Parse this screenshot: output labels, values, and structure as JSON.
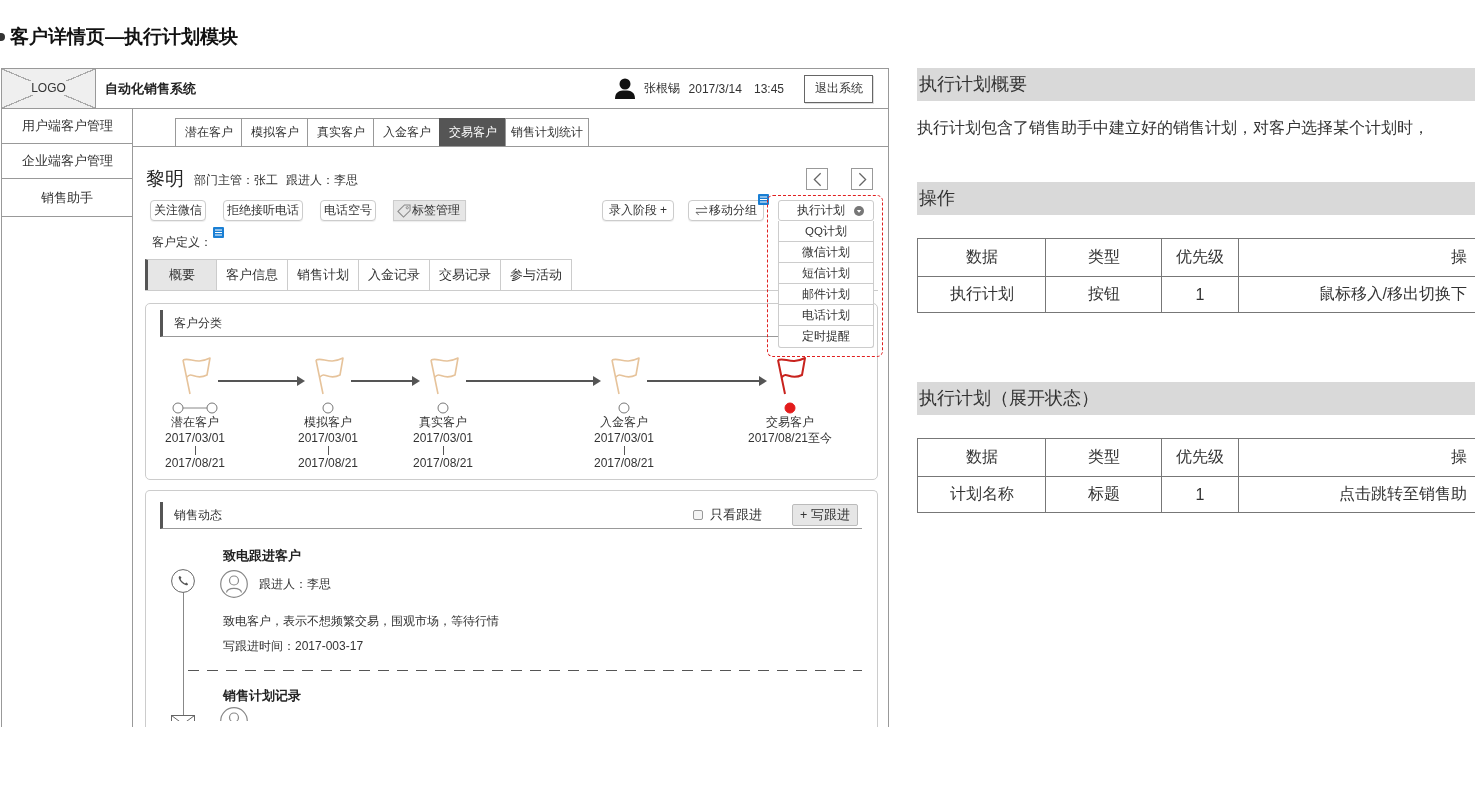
{
  "page": {
    "title": "客户详情页—执行计划模块"
  },
  "wireframe": {
    "header": {
      "logo": "LOGO",
      "system_name": "自动化销售系统",
      "user": "张根锡",
      "date": "2017/3/14",
      "time": "13:45",
      "logout": "退出系统"
    },
    "sidebar": [
      "用户端客户管理",
      "企业端客户管理",
      "销售助手"
    ],
    "top_tabs": [
      {
        "label": "潜在客户",
        "selected": false
      },
      {
        "label": "模拟客户",
        "selected": false
      },
      {
        "label": "真实客户",
        "selected": false
      },
      {
        "label": "入金客户",
        "selected": false
      },
      {
        "label": "交易客户",
        "selected": true
      },
      {
        "label": "销售计划统计",
        "selected": false
      }
    ],
    "customer": {
      "name": "黎明",
      "manager": "部门主管：张工",
      "follower": "跟进人：李思"
    },
    "actions_left": [
      {
        "kind": "plain",
        "label": "关注微信",
        "note_marker": false
      },
      {
        "kind": "plain",
        "label": "拒绝接听电话",
        "note_marker": false
      },
      {
        "kind": "plain",
        "label": "电话空号",
        "note_marker": false
      },
      {
        "kind": "tag",
        "label": "标签管理",
        "note_marker": false
      }
    ],
    "actions_right": [
      {
        "kind": "plain",
        "label": "录入阶段 +",
        "note_marker": false
      },
      {
        "kind": "move",
        "label": "移动分组",
        "note_marker": true
      }
    ],
    "execute_plan": {
      "label": "执行计划",
      "expanded": true,
      "highlighted": true,
      "items": [
        "QQ计划",
        "微信计划",
        "短信计划",
        "邮件计划",
        "电话计划",
        "定时提醒"
      ]
    },
    "customer_definition": {
      "label": "客户定义：",
      "note_marker": true
    },
    "detail_tabs": [
      {
        "label": "概要",
        "selected": true
      },
      {
        "label": "客户信息",
        "selected": false
      },
      {
        "label": "销售计划",
        "selected": false
      },
      {
        "label": "入金记录",
        "selected": false
      },
      {
        "label": "交易记录",
        "selected": false
      },
      {
        "label": "参与活动",
        "selected": false
      }
    ],
    "classification": {
      "title": "客户分类",
      "stages": [
        {
          "kind": "range",
          "name": "潜在客户",
          "start": "2017/03/01",
          "end": "2017/08/21",
          "current": false
        },
        {
          "kind": "point",
          "name": "模拟客户",
          "start": "2017/03/01",
          "end": "2017/08/21",
          "current": false
        },
        {
          "kind": "point",
          "name": "真实客户",
          "start": "2017/03/01",
          "end": "2017/08/21",
          "current": false
        },
        {
          "kind": "point",
          "name": "入金客户",
          "start": "2017/03/01",
          "end": "2017/08/21",
          "current": false
        },
        {
          "kind": "point",
          "name": "交易客户",
          "start": "2017/08/21至今",
          "current": true
        }
      ]
    },
    "sales_activity": {
      "title": "销售动态",
      "filter": {
        "label": "只看跟进",
        "checked": false
      },
      "write_button": "+ 写跟进",
      "entries": [
        {
          "kind": "call",
          "title": "致电跟进客户",
          "follower": "跟进人：李思",
          "note": "致电客户，表示不想频繁交易，围观市场，等待行情",
          "time": "写跟进时间：2017-003-17"
        },
        {
          "kind": "mail",
          "title": "销售计划记录"
        }
      ]
    }
  },
  "document": {
    "sections": [
      {
        "kind": "text",
        "heading": "执行计划概要",
        "text": "执行计划包含了销售助手中建立好的销售计划，对客户选择某个计划时，"
      },
      {
        "kind": "table",
        "heading": "操作",
        "columns": [
          "数据",
          "类型",
          "优先级",
          "操"
        ],
        "rows": [
          [
            "执行计划",
            "按钮",
            "1",
            "鼠标移入/移出切换下"
          ]
        ]
      },
      {
        "kind": "table",
        "heading": "执行计划（展开状态）",
        "columns": [
          "数据",
          "类型",
          "优先级",
          "操"
        ],
        "rows": [
          [
            "计划名称",
            "标题",
            "1",
            "点击跳转至销售助"
          ]
        ]
      }
    ]
  }
}
